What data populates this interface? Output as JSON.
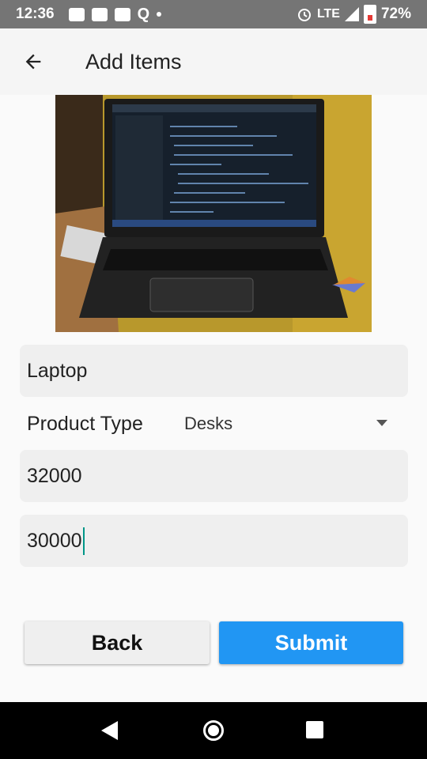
{
  "status_bar": {
    "time": "12:36",
    "network": "LTE",
    "battery": "72%",
    "icons": [
      "image-icon",
      "news-icon",
      "youtube-icon",
      "q-icon",
      "notification-dot-icon",
      "alarm-icon",
      "signal-icon",
      "battery-icon"
    ]
  },
  "app_bar": {
    "title": "Add Items",
    "back_icon": "arrow-back-icon"
  },
  "form": {
    "name_value": "Laptop",
    "product_type_label": "Product Type",
    "product_type_selected": "Desks",
    "price_value": "32000",
    "offer_price_value": "30000"
  },
  "buttons": {
    "back_label": "Back",
    "submit_label": "Submit"
  },
  "colors": {
    "accent": "#2196f3",
    "cursor": "#009688",
    "appbar": "#f5f5f5",
    "field_bg": "#efefef"
  },
  "nav_bar": {
    "icons": [
      "nav-back-icon",
      "nav-home-icon",
      "nav-recents-icon"
    ]
  }
}
